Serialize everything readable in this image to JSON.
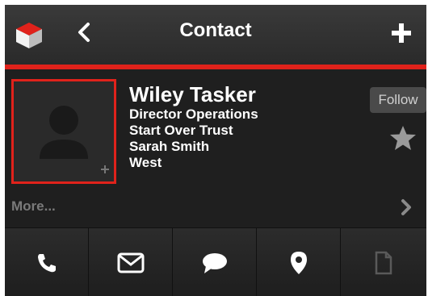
{
  "header": {
    "title": "Contact",
    "back_icon": "chevron-left-icon",
    "add_icon": "plus-icon",
    "logo_icon": "cube-logo-icon",
    "accent": "#e0221b"
  },
  "contact": {
    "name": "Wiley Tasker",
    "title": "Director Operations",
    "company": "Start Over Trust",
    "owner": "Sarah Smith",
    "region": "West"
  },
  "actions": {
    "follow_label": "Follow",
    "more_label": "More..."
  },
  "toolbar": {
    "items": [
      {
        "icon": "phone-icon"
      },
      {
        "icon": "mail-icon"
      },
      {
        "icon": "chat-icon"
      },
      {
        "icon": "map-pin-icon"
      },
      {
        "icon": "document-icon"
      }
    ]
  }
}
